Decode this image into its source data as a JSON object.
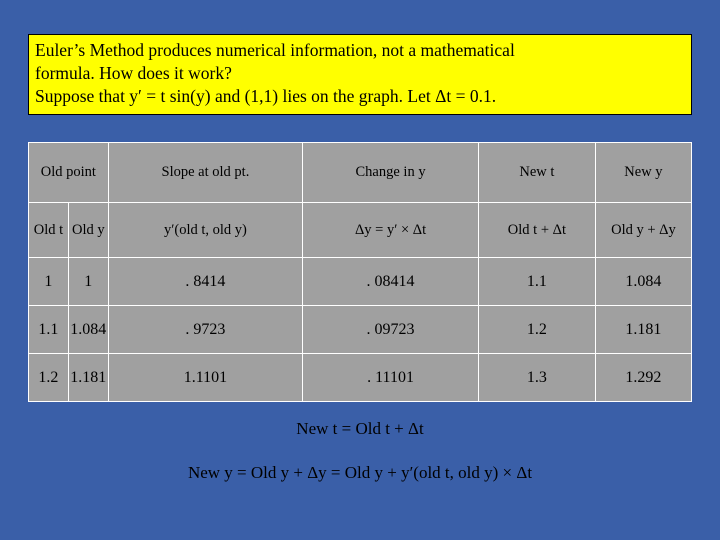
{
  "intro": {
    "line1": "Euler’s Method produces numerical information, not a mathematical",
    "line2": "formula. How does it work?",
    "line3": "Suppose that y′ = t sin(y) and (1,1) lies on the graph. Let Δt = 0.1."
  },
  "table": {
    "headers": {
      "old_point": "Old point",
      "slope": "Slope at old pt.",
      "change": "Change in y",
      "new_t": "New t",
      "new_y": "New y"
    },
    "subheaders": {
      "old_t": "Old t",
      "old_y": "Old y",
      "slope_formula": "y′(old t, old y)",
      "change_formula": "Δy = y′ × Δt",
      "new_t_formula": "Old t + Δt",
      "new_y_formula": "Old y + Δy"
    },
    "rows": [
      {
        "old_t": "1",
        "old_y": "1",
        "slope": ". 8414",
        "change": ". 08414",
        "new_t": "1.1",
        "new_y": "1.084"
      },
      {
        "old_t": "1.1",
        "old_y": "1.084",
        "slope": ". 9723",
        "change": ". 09723",
        "new_t": "1.2",
        "new_y": "1.181"
      },
      {
        "old_t": "1.2",
        "old_y": "1.181",
        "slope": "1.1101",
        "change": ". 11101",
        "new_t": "1.3",
        "new_y": "1.292"
      }
    ]
  },
  "footer": {
    "line1": "New t = Old t + Δt",
    "line2": "New y = Old y + Δy = Old y + y′(old t, old y) × Δt"
  },
  "colors": {
    "background": "#3a5fa8",
    "callout": "#ffff00",
    "table_fill": "#a0a0a0",
    "table_border": "#ffffff"
  }
}
